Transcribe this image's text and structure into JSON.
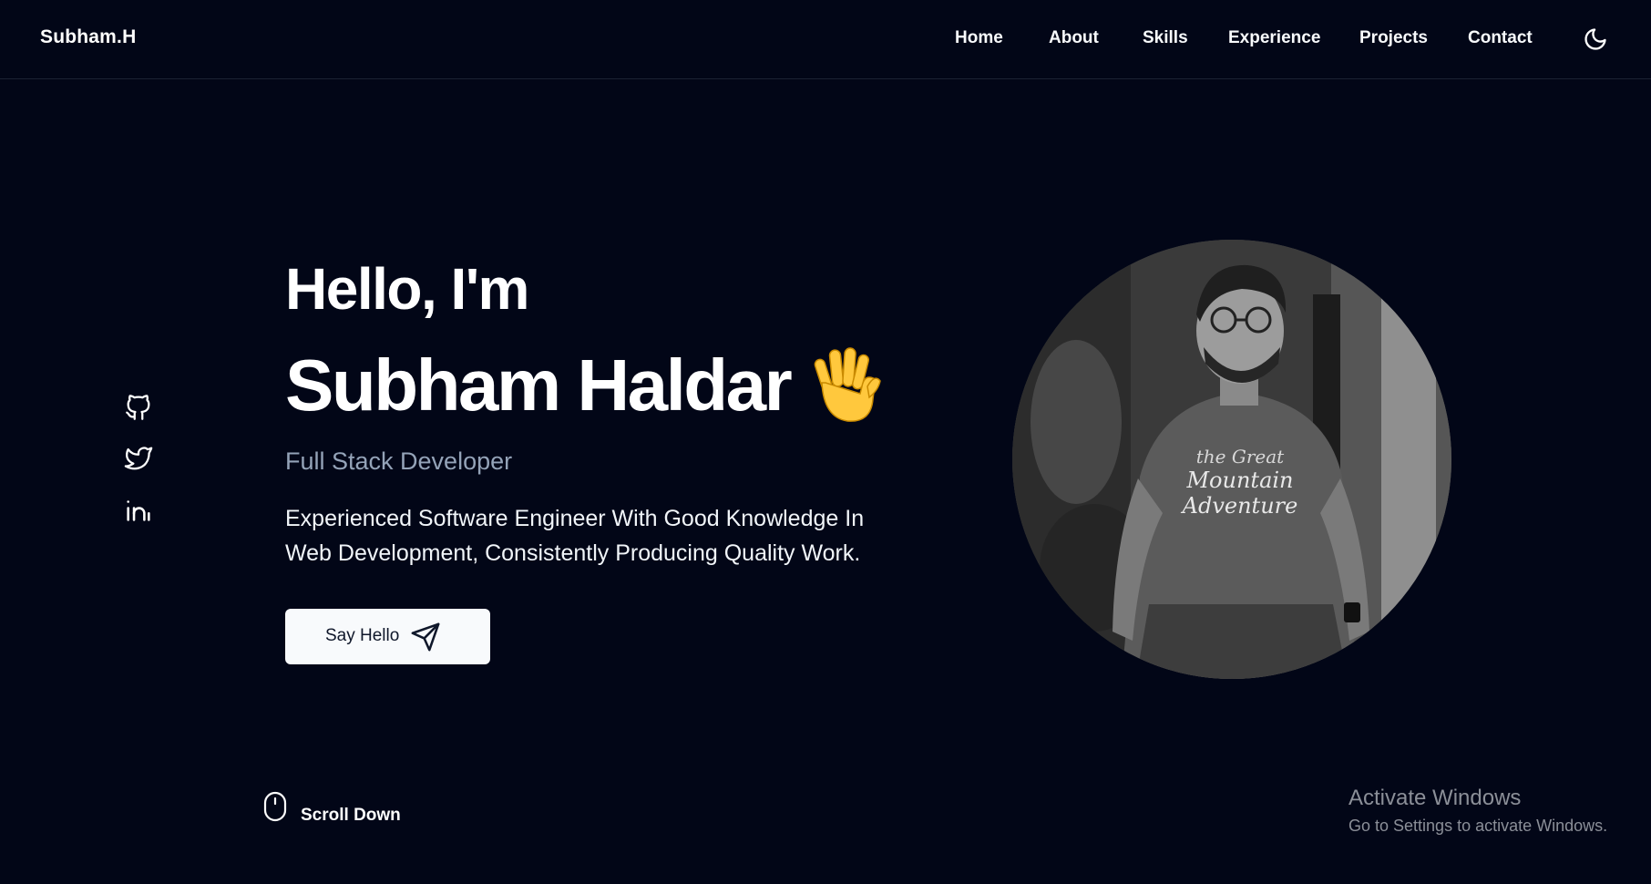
{
  "header": {
    "logo": "Subham.H",
    "nav": [
      "Home",
      "About",
      "Skills",
      "Experience",
      "Projects",
      "Contact"
    ],
    "theme_toggle_icon": "moon-icon"
  },
  "social": {
    "icons": [
      "github-icon",
      "twitter-icon",
      "linkedin-icon"
    ]
  },
  "hero": {
    "greeting": "Hello, I'm",
    "name": "Subham Haldar",
    "wave_icon": "raised-hand-emoji",
    "role": "Full Stack Developer",
    "description": "Experienced Software Engineer With Good Knowledge In Web Development, Consistently Producing Quality Work.",
    "cta_label": "Say Hello",
    "cta_icon": "send-icon",
    "avatar_alt": "profile-photo"
  },
  "scroll": {
    "label": "Scroll Down",
    "icon": "mouse-icon"
  },
  "watermark": {
    "title": "Activate Windows",
    "subtitle": "Go to Settings to activate Windows."
  },
  "colors": {
    "background": "#020617",
    "text": "#ffffff",
    "muted": "#94a3b8",
    "button_bg": "#f8fafc",
    "button_text": "#0f172a"
  }
}
